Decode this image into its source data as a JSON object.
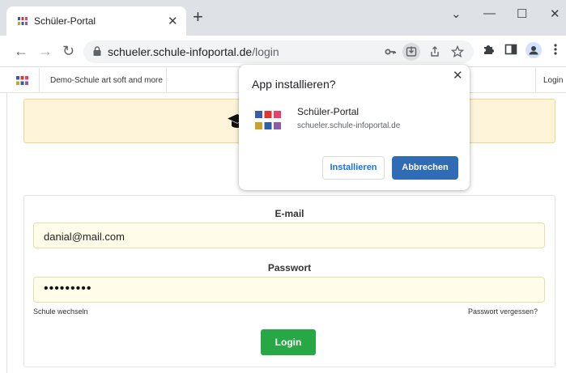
{
  "browser": {
    "tab_title": "Schüler-Portal",
    "tab_close": "✕",
    "new_tab": "+",
    "url_host": "schueler.schule-infoportal.de",
    "url_path": "/login",
    "window_minimize": "—",
    "window_maximize": "☐",
    "window_close": "✕",
    "window_dropdown": "⌄",
    "icons": [
      "back-icon",
      "forward-icon",
      "reload-icon",
      "lock-icon",
      "key-icon",
      "install-app-icon",
      "share-icon",
      "star-icon",
      "extensions-icon",
      "sidepanel-icon",
      "profile-icon",
      "menu-icon"
    ]
  },
  "site_nav": {
    "school_name": "Demo-Schule art soft and more",
    "login_link": "Login"
  },
  "login_form": {
    "email_label": "E-mail",
    "email_value": "danial@mail.com",
    "password_label": "Passwort",
    "password_value": "•••••••••",
    "change_school_link": "Schule wechseln",
    "forgot_password_link": "Passwort vergessen?",
    "login_button": "Login"
  },
  "install_popup": {
    "title": "App installieren?",
    "close": "✕",
    "app_name": "Schüler-Portal",
    "app_url": "schueler.schule-infoportal.de",
    "install_button": "Installieren",
    "cancel_button": "Abbrechen"
  },
  "colors": {
    "login_button": "#28a745",
    "cancel_button": "#2f6cb5",
    "banner_background": "#fdf4d9",
    "input_background": "#fffdea"
  }
}
